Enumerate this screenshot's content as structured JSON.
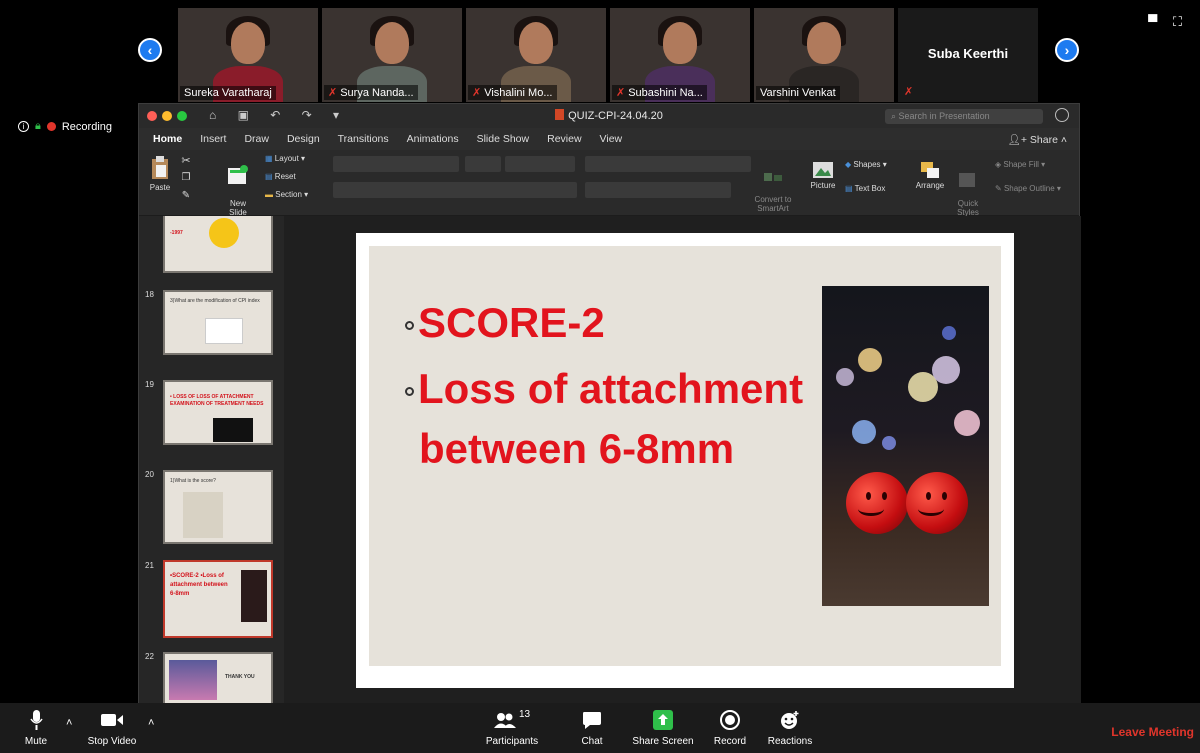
{
  "participants": [
    {
      "name": "Sureka Varatharaj",
      "muted": false,
      "shirt": "#8a1c2a"
    },
    {
      "name": "Surya Nanda...",
      "muted": true,
      "shirt": "#6a6f66"
    },
    {
      "name": "Vishalini Mo...",
      "muted": true,
      "shirt": "#6b5a48"
    },
    {
      "name": "Subashini Na...",
      "muted": true,
      "shirt": "#4a2f5a"
    },
    {
      "name": "Varshini Venkat",
      "muted": false,
      "shirt": "#2a2624"
    }
  ],
  "participant_text_tile": {
    "name": "Suba Keerthi",
    "muted": true
  },
  "recording_label": "Recording",
  "ppt": {
    "doc_title": "QUIZ-CPI-24.04.20",
    "search_placeholder": "Search in Presentation",
    "tabs": [
      "Home",
      "Insert",
      "Draw",
      "Design",
      "Transitions",
      "Animations",
      "Slide Show",
      "Review",
      "View"
    ],
    "active_tab": "Home",
    "share_label": "Share",
    "ribbon": {
      "paste": "Paste",
      "new_slide": "New\nSlide",
      "layout": "Layout",
      "reset": "Reset",
      "section": "Section",
      "convert": "Convert to\nSmartArt",
      "picture": "Picture",
      "shapes": "Shapes",
      "text_box": "Text Box",
      "arrange": "Arrange",
      "quick_styles": "Quick\nStyles",
      "shape_fill": "Shape Fill",
      "shape_outline": "Shape Outline"
    },
    "thumbnails": [
      {
        "num": "",
        "text": "-1997"
      },
      {
        "num": "18",
        "text": "3)What are the modification of CPI index"
      },
      {
        "num": "19",
        "text": "• LOSS OF LOSS OF ATTACHMENT  EXAMINATION OF TREATMENT NEEDS"
      },
      {
        "num": "20",
        "text": "1)What is the score?"
      },
      {
        "num": "21",
        "text": "•SCORE-2  •Loss of attachment between 6-8mm",
        "selected": true
      },
      {
        "num": "22",
        "text": "THANK YOU"
      }
    ],
    "slide": {
      "bullets": [
        "SCORE-2",
        "Loss of attachment",
        "between  6-8mm"
      ]
    }
  },
  "toolbar": {
    "mute": "Mute",
    "stop_video": "Stop Video",
    "participants": "Participants",
    "participants_count": "13",
    "chat": "Chat",
    "share_screen": "Share Screen",
    "record": "Record",
    "reactions": "Reactions",
    "leave": "Leave Meeting"
  },
  "colors": {
    "slide_text": "#e2141d",
    "share_green": "#2fbf4a",
    "leave_red": "#e0352b",
    "nav_blue": "#1e7bf0"
  }
}
